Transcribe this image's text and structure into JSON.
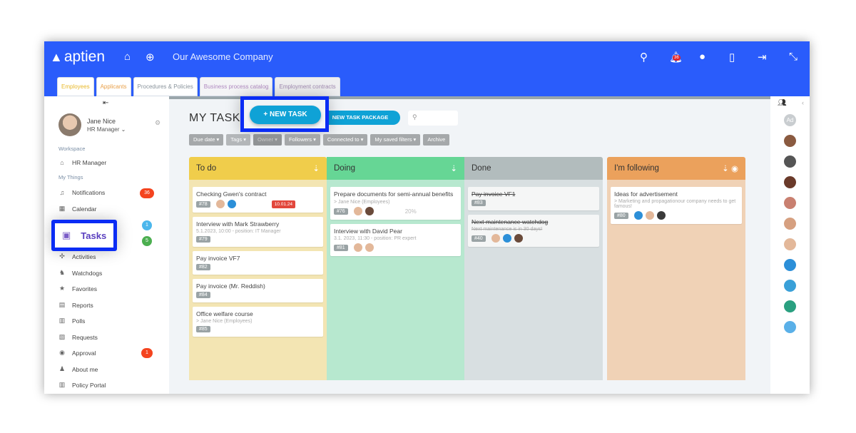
{
  "header": {
    "logo": "aptien",
    "company": "Our Awesome Company",
    "notification_count": "36",
    "icons": [
      "home-icon",
      "plus-circle-icon",
      "search-icon",
      "bell-icon",
      "chat-icon",
      "mobile-icon",
      "logout-icon",
      "collapse-icon"
    ]
  },
  "tabs": [
    {
      "label": "Employees",
      "color": "#e8b82a"
    },
    {
      "label": "Applicants",
      "color": "#e8a04a"
    },
    {
      "label": "Procedures & Policies",
      "color": "#8a949c"
    },
    {
      "label": "Business process catalog",
      "color": "#b08ac0"
    },
    {
      "label": "Employment contracts",
      "color": "#a08ab0"
    }
  ],
  "user": {
    "name": "Jane Nice",
    "role": "HR Manager"
  },
  "sidebar": {
    "workspace_label": "Workspace",
    "workspace_item": "HR Manager",
    "mythings_label": "My Things",
    "items": [
      {
        "label": "Notifications",
        "badge": "36",
        "badge_color": "#f4441f"
      },
      {
        "label": "Calendar"
      },
      {
        "label": "Tasks",
        "badges": [
          "1",
          "5"
        ]
      },
      {
        "label": "Activities"
      },
      {
        "label": "Watchdogs"
      },
      {
        "label": "Favorites"
      },
      {
        "label": "Reports"
      },
      {
        "label": "Polls"
      },
      {
        "label": "Requests"
      },
      {
        "label": "Approval",
        "badge": "1",
        "badge_color": "#f4441f"
      },
      {
        "label": "About me"
      },
      {
        "label": "Policy Portal"
      }
    ]
  },
  "main": {
    "title": "MY TASKS",
    "new_task": "+ NEW TASK",
    "new_package": "NEW TASK PACKAGE",
    "filters": [
      "Due date ▾",
      "Tags ▾",
      "Owner ▾",
      "Followers ▾",
      "Connected to ▾",
      "My saved filters ▾",
      "Archive"
    ]
  },
  "columns": [
    {
      "title": "To do",
      "header_color": "#f0cd4b",
      "body_color": "#f3e5b3",
      "cards": [
        {
          "title": "Checking Gwen's contract",
          "id": "#78",
          "due": "10.01.24"
        },
        {
          "title": "Interview with Mark Strawberry",
          "sub": "5.1.2023, 10:00 - position: IT Manager",
          "id": "#79"
        },
        {
          "title": "Pay invoice VF7",
          "id": "#82"
        },
        {
          "title": "Pay invoice (Mr. Reddish)",
          "id": "#84"
        },
        {
          "title": "Office welfare course",
          "sub": "> Jane Nice (Employees)",
          "id": "#85"
        }
      ]
    },
    {
      "title": "Doing",
      "header_color": "#66d695",
      "body_color": "#b7e8cf",
      "cards": [
        {
          "title": "Prepare documents for semi-annual benefits",
          "inline_sub": "> Jane Nice (Employees)",
          "id": "#76",
          "progress": "20%"
        },
        {
          "title": "Interview with David Pear",
          "sub": "3.1. 2023, 11:30 - position: PR expert",
          "id": "#81"
        }
      ]
    },
    {
      "title": "Done",
      "header_color": "#b2bcbd",
      "body_color": "#d8dfe1",
      "cards": [
        {
          "title": "Pay invoice VF1",
          "id": "#83"
        },
        {
          "title": "Next maintenance watchdog",
          "sub": "Next maintenance is in 30 days!",
          "id": "#40"
        }
      ]
    },
    {
      "title": "I'm following",
      "header_color": "#eba15c",
      "body_color": "#f0d2b6",
      "cards": [
        {
          "title": "Ideas for advertisement",
          "sub": "> Marketing and propagationour company needs to get famous!",
          "id": "#80"
        }
      ]
    }
  ],
  "right_panel": {
    "initials": "Ad"
  }
}
